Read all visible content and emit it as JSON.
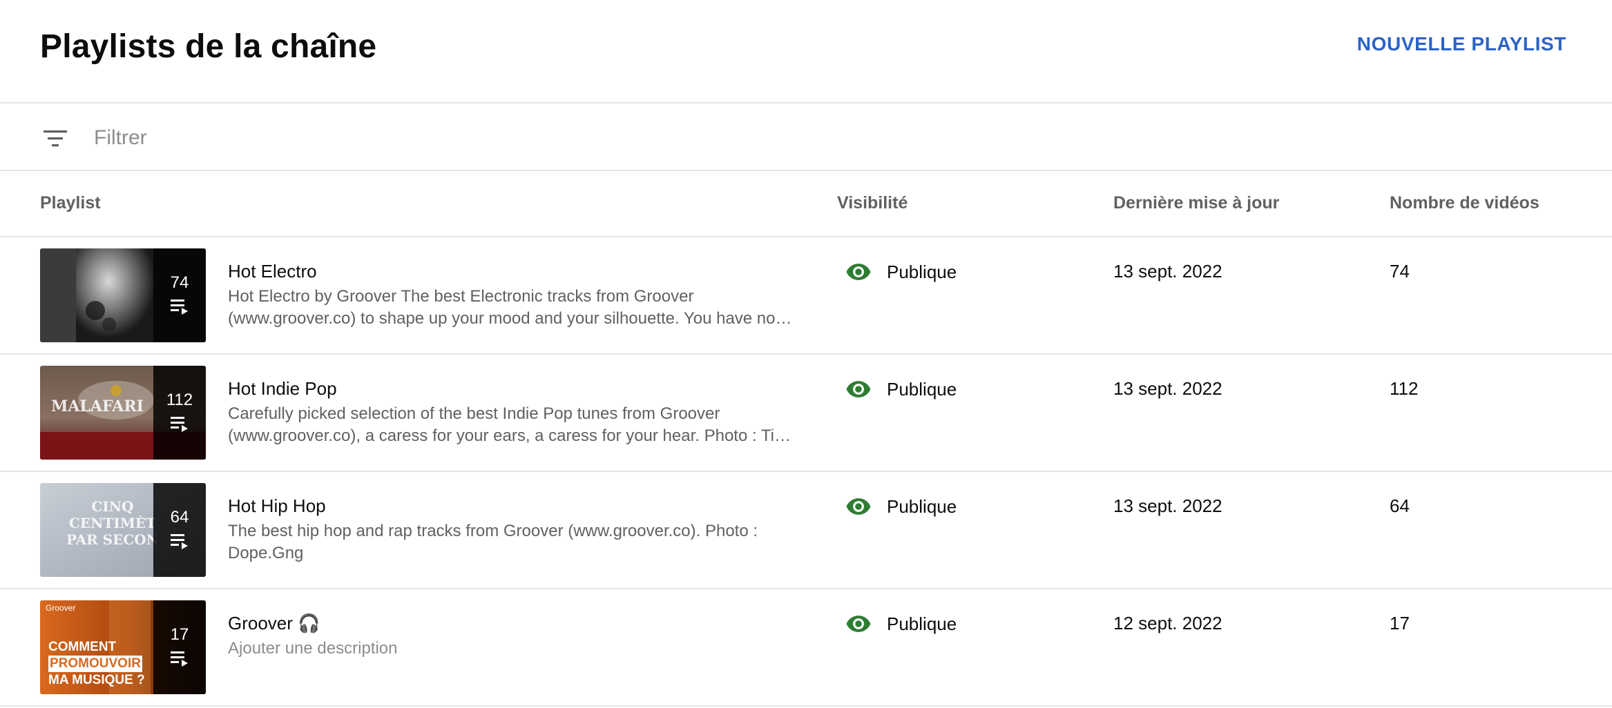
{
  "header": {
    "title": "Playlists de la chaîne",
    "new_playlist_label": "NOUVELLE PLAYLIST"
  },
  "filter": {
    "placeholder": "Filtrer",
    "icon": "filter-icon"
  },
  "columns": {
    "playlist": "Playlist",
    "visibility": "Visibilité",
    "last_update": "Dernière mise à jour",
    "video_count": "Nombre de vidéos"
  },
  "colors": {
    "accent": "#2b63c6",
    "visibility_icon": "#2e7d32",
    "secondary_text": "#606060",
    "divider": "#e6e6e6"
  },
  "playlists": [
    {
      "title": "Hot Electro",
      "description": "Hot Electro by Groover The best Electronic tracks from Groover (www.groover.co) to shape up your mood and your silhouette. You have no…",
      "visibility": "Publique",
      "updated": "13 sept. 2022",
      "count": "74",
      "thumb_count": "74"
    },
    {
      "title": "Hot Indie Pop",
      "description": "Carefully picked selection of the best Indie Pop tunes from Groover (www.groover.co), a caress for your ears, a caress for your hear. Photo : Ti…",
      "visibility": "Publique",
      "updated": "13 sept. 2022",
      "count": "112",
      "thumb_count": "112",
      "thumb_text": "MALAFARI"
    },
    {
      "title": "Hot Hip Hop",
      "description": "The best hip hop and rap tracks from Groover (www.groover.co). Photo : Dope.Gng",
      "visibility": "Publique",
      "updated": "13 sept. 2022",
      "count": "64",
      "thumb_count": "64",
      "thumb_text": [
        "CINQ",
        "CENTIMÈT",
        "PAR SECON"
      ]
    },
    {
      "title": "Groover 🎧",
      "description": "Ajouter une description",
      "visibility": "Publique",
      "updated": "12 sept. 2022",
      "count": "17",
      "thumb_count": "17",
      "thumb_text": [
        "Groover",
        "COMMENT",
        "PROMOUVOIR",
        "MA MUSIQUE ?"
      ]
    }
  ]
}
